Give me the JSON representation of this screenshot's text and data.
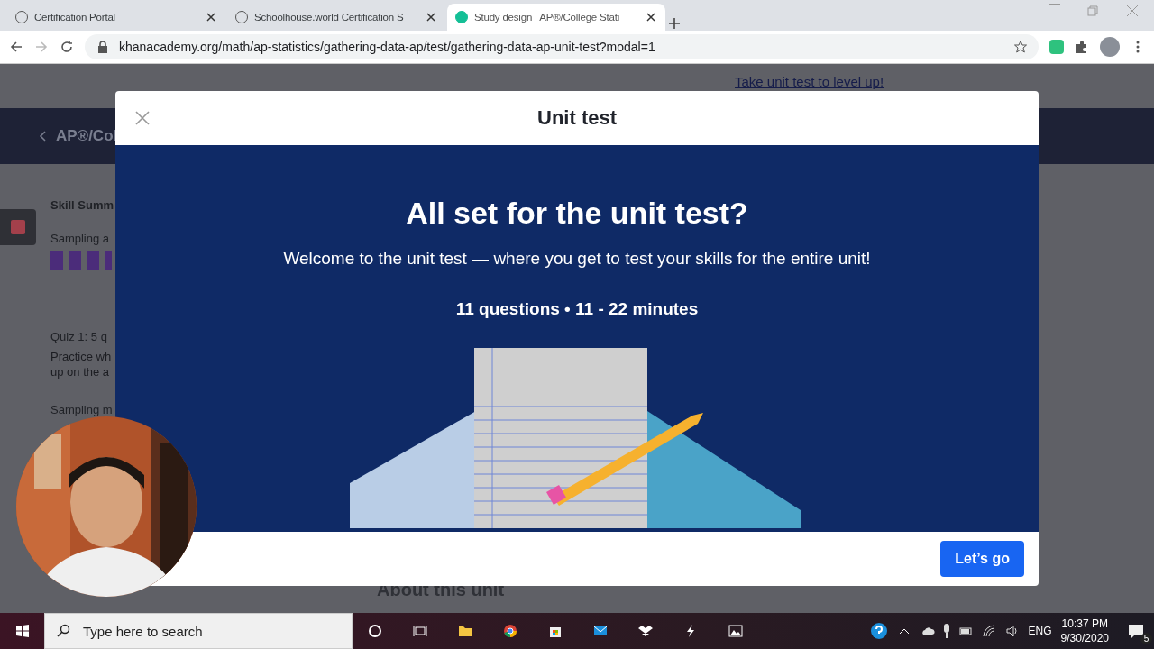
{
  "browser": {
    "tabs": [
      {
        "title": "Certification Portal",
        "selected": false
      },
      {
        "title": "Schoolhouse.world Certification S",
        "selected": false
      },
      {
        "title": "Study design | AP®/College Stati",
        "selected": true
      }
    ],
    "address": "khanacademy.org/math/ap-statistics/gathering-data-ap/test/gathering-data-ap-unit-test?modal=1"
  },
  "background_page": {
    "banner_link": "Take unit test to level up!",
    "course_title": "AP®/Col",
    "sidebar": [
      {
        "kind": "heading",
        "text": "Skill Summ"
      },
      {
        "kind": "title",
        "text": "Sampling a"
      },
      {
        "kind": "mastery"
      },
      {
        "kind": "title",
        "text": "Quiz 1: 5 q"
      },
      {
        "kind": "description",
        "text": "Practice wh"
      },
      {
        "kind": "description",
        "text": "up on the a"
      },
      {
        "kind": "title",
        "text": "Sampling m"
      }
    ],
    "section_heading": "About this unit"
  },
  "modal": {
    "title": "Unit test",
    "heading": "All set for the unit test?",
    "intro": "Welcome to the unit test — where you get to test your skills for the entire unit!",
    "details": "11 questions • 11 - 22 minutes",
    "button": "Let’s go"
  },
  "taskbar": {
    "search_placeholder": "Type here to search",
    "language": "ENG",
    "time": "10:37 PM",
    "date": "9/30/2020",
    "notification_count": "5"
  }
}
